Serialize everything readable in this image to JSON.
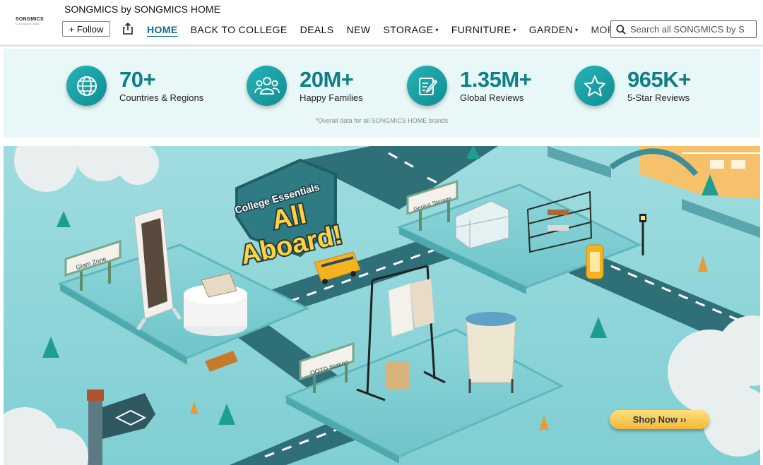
{
  "header": {
    "logo_text": "SONGMICS",
    "logo_subtext": "by SONGMICS HOME",
    "store_title": "SONGMICS by SONGMICS HOME",
    "follow_label": "+ Follow",
    "nav": [
      {
        "label": "HOME",
        "active": true,
        "caret": ""
      },
      {
        "label": "BACK TO COLLEGE",
        "caret": ""
      },
      {
        "label": "DEALS",
        "caret": ""
      },
      {
        "label": "NEW",
        "caret": ""
      },
      {
        "label": "STORAGE",
        "caret": "▾"
      },
      {
        "label": "FURNITURE",
        "caret": "▾"
      },
      {
        "label": "GARDEN",
        "caret": "▾"
      },
      {
        "label": "MORE",
        "caret": "▾"
      }
    ],
    "search_placeholder": "Search all SONGMICS by S"
  },
  "stats": {
    "items": [
      {
        "value": "70+",
        "label": "Countries & Regions",
        "icon": "globe-icon"
      },
      {
        "value": "20M+",
        "label": "Happy Families",
        "icon": "people-icon"
      },
      {
        "value": "1.35M+",
        "label": "Global Reviews",
        "icon": "review-pen-icon"
      },
      {
        "value": "965K+",
        "label": "5-Star Reviews",
        "icon": "star-icon"
      }
    ],
    "footnote": "*Overall data for all SONGMICS HOME brands"
  },
  "banner": {
    "headline_top": "College Essentials",
    "headline_line1": "All",
    "headline_line2": "Aboard!",
    "signs": [
      "Glam Zone",
      "Genius Storage",
      "OOTD Station"
    ],
    "shop_button": "Shop Now ››"
  },
  "colors": {
    "accent": "#0e7f87",
    "nav_active": "#0a6a8a",
    "stats_bg": "#e8f7f7",
    "banner_bg": "#a9e0e3",
    "button_gold": "#f6b83a"
  }
}
